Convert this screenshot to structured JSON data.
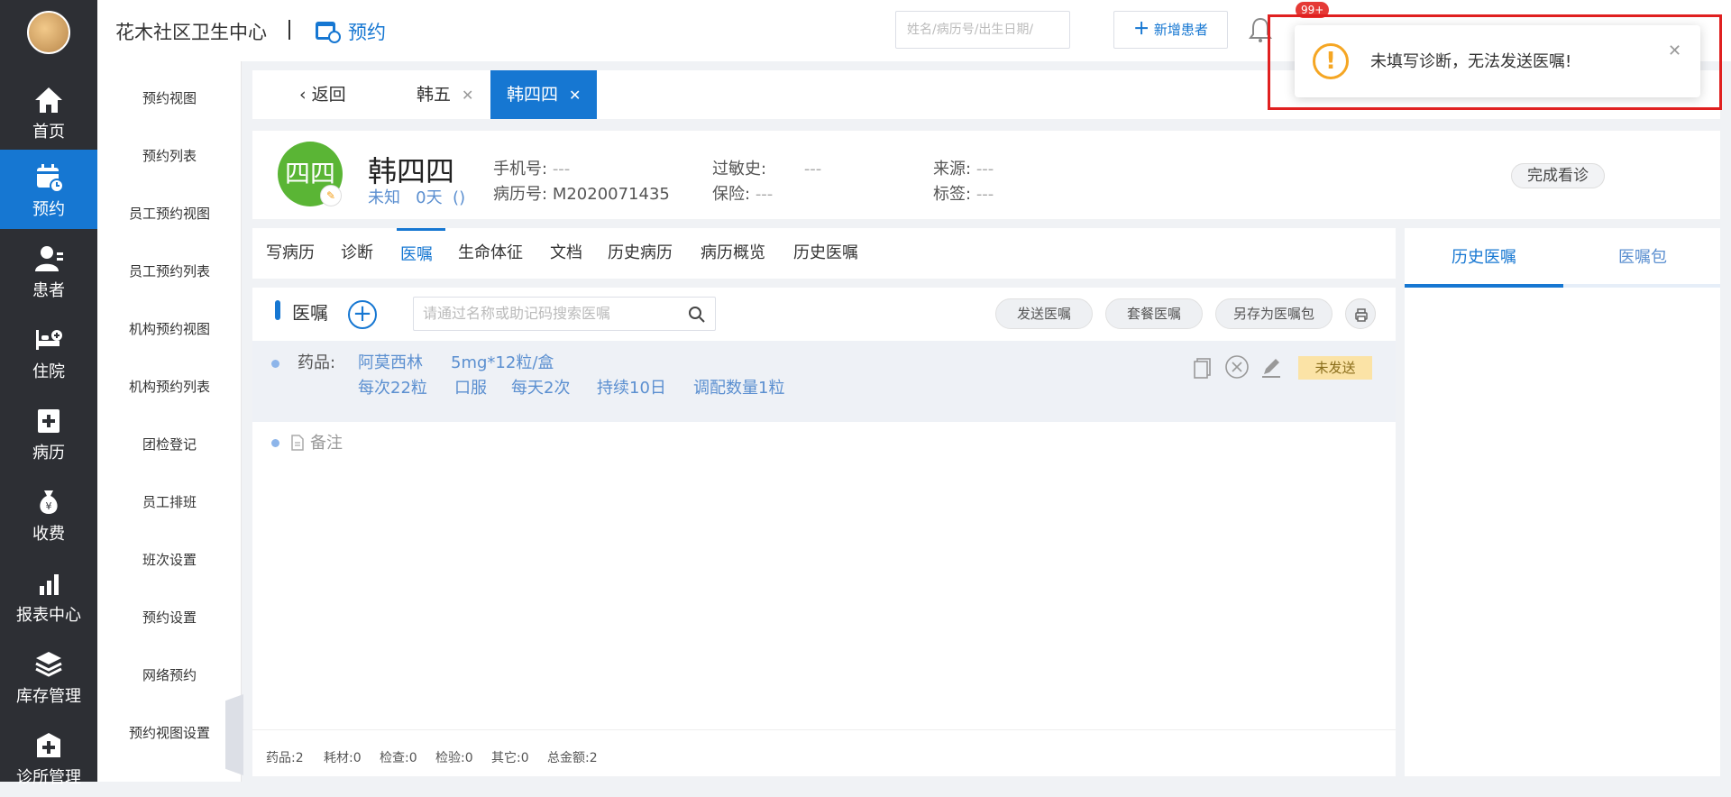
{
  "sidebar": {
    "items": [
      {
        "label": "首页",
        "icon": "home-icon"
      },
      {
        "label": "预约",
        "icon": "calendar-icon",
        "active": true
      },
      {
        "label": "患者",
        "icon": "user-icon"
      },
      {
        "label": "住院",
        "icon": "bed-icon"
      },
      {
        "label": "病历",
        "icon": "medical-record-icon"
      },
      {
        "label": "收费",
        "icon": "money-bag-icon"
      },
      {
        "label": "报表中心",
        "icon": "bar-chart-icon"
      },
      {
        "label": "库存管理",
        "icon": "layers-icon"
      },
      {
        "label": "诊所管理",
        "icon": "clinic-icon"
      }
    ]
  },
  "submenu": {
    "items": [
      "预约视图",
      "预约列表",
      "员工预约视图",
      "员工预约列表",
      "机构预约视图",
      "机构预约列表",
      "团检登记",
      "员工排班",
      "班次设置",
      "预约设置",
      "网络预约",
      "预约视图设置"
    ]
  },
  "header": {
    "clinic_name": "花木社区卫生中心",
    "section": "预约",
    "search_placeholder": "姓名/病历号/出生日期/",
    "new_patient": "新增患者",
    "notify_badge": "99+"
  },
  "tabs": {
    "back": "返回",
    "items": [
      {
        "label": "韩五",
        "active": false
      },
      {
        "label": "韩四四",
        "active": true
      }
    ]
  },
  "patient": {
    "avatar_text": "四四",
    "name": "韩四四",
    "sub": "未知   0天  ()",
    "phone_label": "手机号:",
    "phone": "---",
    "record_label": "病历号:",
    "record": "M2020071435",
    "allergy_label": "过敏史:",
    "allergy": "---",
    "insurance_label": "保险:",
    "insurance": "---",
    "source_label": "来源:",
    "source": "---",
    "tags_label": "标签:",
    "tags": "---",
    "finish_button": "完成看诊"
  },
  "main": {
    "tabs": [
      "写病历",
      "诊断",
      "医嘱",
      "生命体征",
      "文档",
      "历史病历",
      "病历概览",
      "历史医嘱"
    ],
    "active_tab": "医嘱",
    "section_title": "医嘱",
    "search_placeholder": "请通过名称或助记码搜索医嘱",
    "send_button": "发送医嘱",
    "package_button": "套餐医嘱",
    "save_as_button": "另存为医嘱包",
    "order": {
      "label": "药品:",
      "drug": "阿莫西林",
      "spec": "5mg*12粒/盒",
      "dose": "每次22粒",
      "route": "口服",
      "freq": "每天2次",
      "duration": "持续10日",
      "qty": "调配数量1粒",
      "status": "未发送"
    },
    "note_label": "备注",
    "footer": {
      "drugs": "药品:2",
      "consumables": "耗材:0",
      "exam": "检查:0",
      "test": "检验:0",
      "other": "其它:0",
      "total": "总金额:2"
    }
  },
  "right": {
    "tabs": [
      "历史医嘱",
      "医嘱包"
    ]
  },
  "toast": {
    "message": "未填写诊断，无法发送医嘱!"
  },
  "colors": {
    "primary": "#1677d2",
    "sidebar": "#2d2f34",
    "warning": "#f5a623",
    "highlight": "#e02020"
  }
}
